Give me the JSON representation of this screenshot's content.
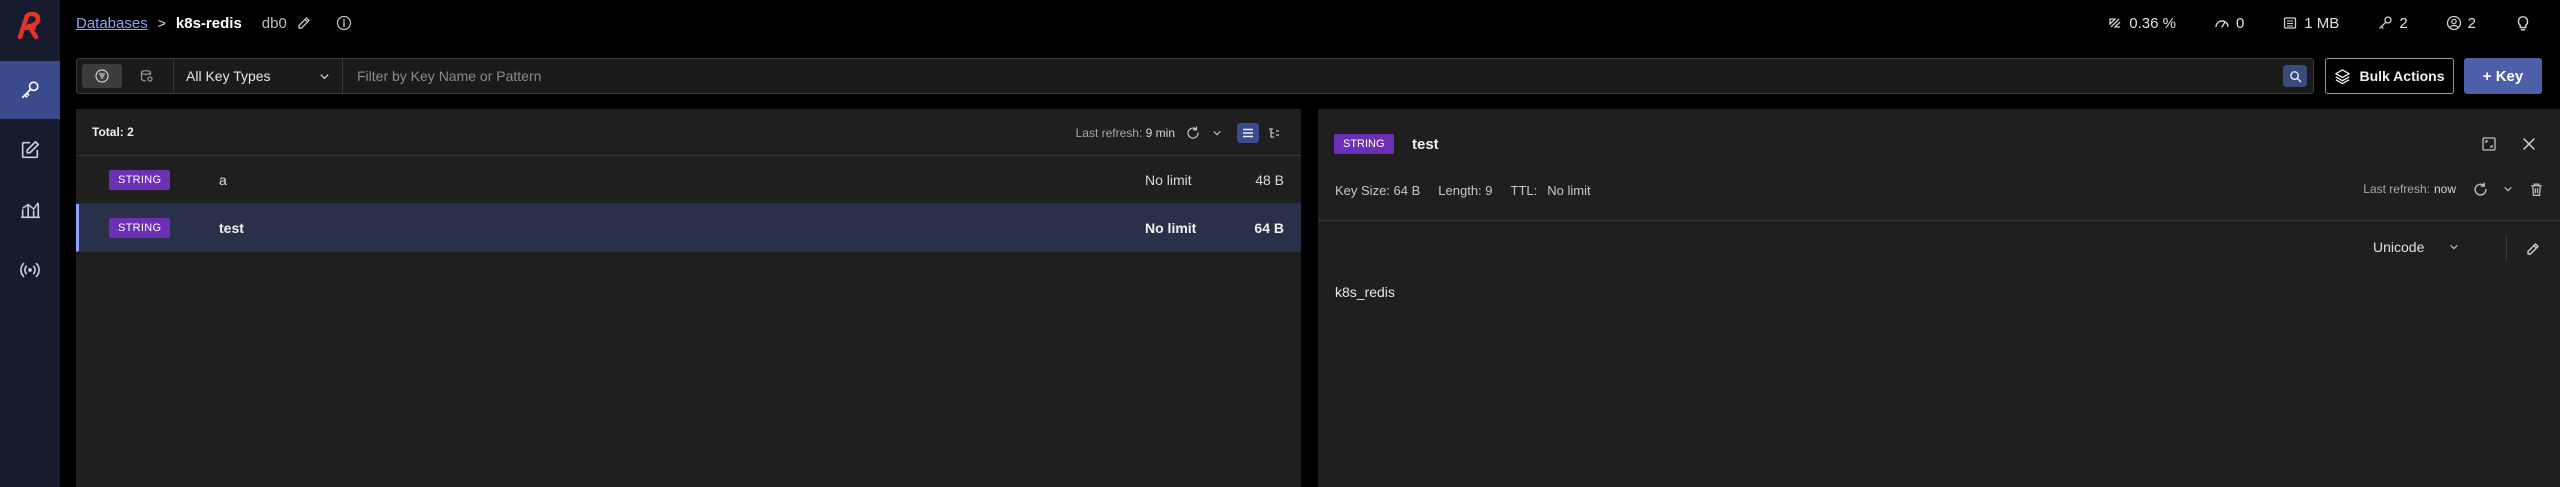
{
  "breadcrumb": {
    "databases_link": "Databases",
    "separator": ">",
    "database_name": "k8s-redis",
    "index": "db0"
  },
  "stats": {
    "cpu": "0.36 %",
    "ops": "0",
    "memory": "1 MB",
    "keys": "2",
    "clients": "2"
  },
  "filter": {
    "key_type": "All Key Types",
    "placeholder": "Filter by Key Name or Pattern",
    "value": ""
  },
  "actions": {
    "bulk_actions": "Bulk Actions",
    "add_key": "+ Key"
  },
  "list": {
    "total": "Total: 2",
    "refresh_label": "Last refresh:",
    "refresh_value": "9 min",
    "rows": [
      {
        "type": "STRING",
        "name": "a",
        "ttl": "No limit",
        "size": "48 B",
        "selected": false
      },
      {
        "type": "STRING",
        "name": "test",
        "ttl": "No limit",
        "size": "64 B",
        "selected": true
      }
    ]
  },
  "detail": {
    "type": "STRING",
    "key": "test",
    "key_size": "Key Size: 64 B",
    "length": "Length: 9",
    "ttl": "TTL:",
    "ttl_value": "No limit",
    "refresh_label": "Last refresh:",
    "refresh_value": "now",
    "format": "Unicode",
    "value": "k8s_redis"
  },
  "colors": {
    "accent": "#8ba2ff",
    "badge_string": "#6c2fb6",
    "primary_button": "#4d5fa8",
    "sidebar": "#161b2e",
    "selected_row": "#29314a"
  }
}
